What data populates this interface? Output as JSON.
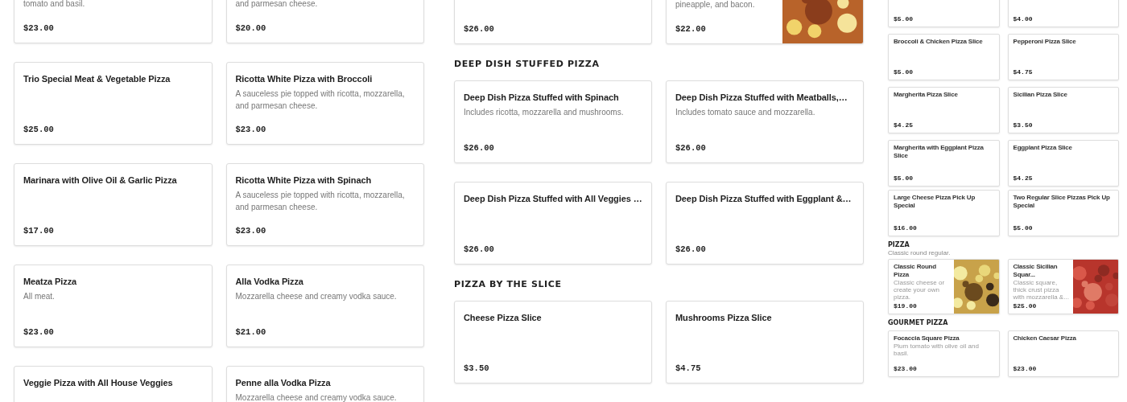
{
  "panels": [
    {
      "kind": "full",
      "sections": [
        {
          "items": [
            {
              "description": "tomato and basil.",
              "price": "$23.00"
            },
            {
              "description": "and parmesan cheese.",
              "price": "$20.00"
            },
            {
              "title": "Trio Special Meat & Vegetable Pizza",
              "price": "$25.00"
            },
            {
              "title": "Ricotta White Pizza with Broccoli",
              "description": "A sauceless pie topped with ricotta, mozzarella, and parmesan cheese.",
              "price": "$23.00"
            },
            {
              "title": "Marinara with Olive Oil & Garlic Pizza",
              "price": "$17.00"
            },
            {
              "title": "Ricotta White Pizza with Spinach",
              "description": "A sauceless pie topped with ricotta, mozzarella, and parmesan cheese.",
              "price": "$23.00"
            },
            {
              "title": "Meatza Pizza",
              "description": "All meat.",
              "price": "$23.00"
            },
            {
              "title": "Alla Vodka Pizza",
              "description": "Mozzarella cheese and creamy vodka sauce.",
              "price": "$21.00"
            },
            {
              "title": "Veggie Pizza with All House Veggies"
            },
            {
              "title": "Penne alla Vodka Pizza",
              "description": "Mozzarella cheese and creamy vodka sauce."
            }
          ]
        }
      ]
    },
    {
      "kind": "full",
      "sections": [
        {
          "items": [
            {
              "price": "$26.00"
            },
            {
              "description": "pineapple, and bacon.",
              "price": "$22.00",
              "image": true
            }
          ]
        },
        {
          "heading": "DEEP DISH STUFFED PIZZA",
          "items": [
            {
              "title": "Deep Dish Pizza Stuffed with Spinach",
              "description": "Includes ricotta, mozzarella and mushrooms.",
              "price": "$26.00"
            },
            {
              "title": "Deep Dish Pizza Stuffed with Meatballs,…",
              "description": "Includes tomato sauce and mozzarella.",
              "price": "$26.00"
            },
            {
              "title": "Deep Dish Pizza Stuffed with All Veggies …",
              "price": "$26.00"
            },
            {
              "title": "Deep Dish Pizza Stuffed with Eggplant &…",
              "price": "$26.00"
            }
          ]
        },
        {
          "heading": "PIZZA BY THE SLICE",
          "items": [
            {
              "title": "Cheese Pizza Slice",
              "price": "$3.50"
            },
            {
              "title": "Mushrooms Pizza Slice",
              "price": "$4.75"
            }
          ]
        }
      ]
    },
    {
      "kind": "mini",
      "sections": [
        {
          "items": [
            {
              "price": "$5.00"
            },
            {
              "price": "$4.00"
            },
            {
              "title": "Broccoli & Chicken Pizza Slice",
              "price": "$5.00"
            },
            {
              "title": "Pepperoni Pizza Slice",
              "price": "$4.75"
            },
            {
              "title": "Margherita Pizza Slice",
              "price": "$4.25"
            },
            {
              "title": "Sicilian Pizza Slice",
              "price": "$3.50"
            },
            {
              "title": "Margherita with Eggplant Pizza Slice",
              "price": "$5.00"
            },
            {
              "title": "Eggplant Pizza Slice",
              "price": "$4.25"
            }
          ]
        },
        {
          "items": [
            {
              "title": "Large Cheese Pizza Pick Up Special",
              "price": "$16.00"
            },
            {
              "title": "Two Regular Slice Pizzas Pick Up Special",
              "price": "$5.00"
            }
          ]
        },
        {
          "heading": "PIZZA",
          "subtitle": "Classic round regular.",
          "items": [
            {
              "title": "Classic Round Pizza",
              "description": "Classic cheese or create your own pizza.",
              "price": "$19.00",
              "image": true
            },
            {
              "title": "Classic Sicilian Squar...",
              "description": "Classic square, thick crust pizza with mozzarella &...",
              "price": "$25.00",
              "image": true
            }
          ]
        },
        {
          "heading": "GOURMET PIZZA",
          "items": [
            {
              "title": "Focaccia Square Pizza",
              "description": "Plum tomato with olive oil and basil.",
              "price": "$23.00"
            },
            {
              "title": "Chicken Caesar Pizza",
              "price": "$23.00"
            }
          ]
        }
      ]
    }
  ]
}
